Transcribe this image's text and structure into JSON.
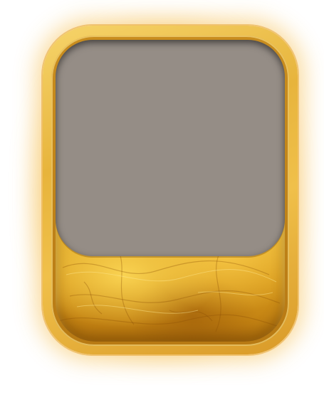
{
  "card": {
    "frame_color": "#e9b83f",
    "portrait_placeholder_color": "#958d86",
    "plate_color": "#e8b02a"
  }
}
